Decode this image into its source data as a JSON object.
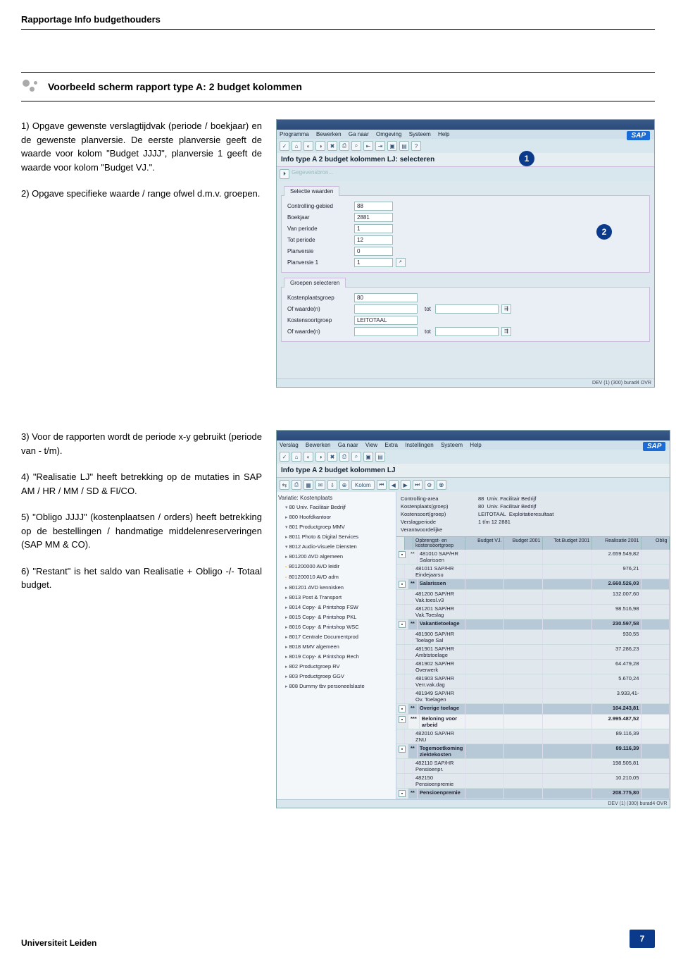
{
  "doc_header": "Rapportage Info budgethouders",
  "section_title": "Voorbeeld scherm rapport type A: 2 budget kolommen",
  "paragraphs_block1": [
    "1) Opgave gewenste verslagtijdvak (periode / boekjaar) en de gewenste planversie. De eerste planversie geeft de waarde voor kolom \"Budget JJJJ\", planversie 1 geeft de waarde voor kolom \"Budget VJ.\".",
    "2) Opgave specifieke waarde / range ofwel d.m.v. groepen."
  ],
  "paragraphs_block2": [
    "3) Voor de rapporten wordt de periode x-y gebruikt (periode van - t/m).",
    "4) \"Realisatie LJ\" heeft betrekking op de mutaties in SAP AM / HR / MM / SD & FI/CO.",
    "5) \"Obligo JJJJ\" (kostenplaatsen / orders) heeft betrekking op de bestellingen / handmatige middelenreserveringen (SAP MM & CO).",
    "6) \"Restant\" is het saldo van Realisatie + Obligo -/- Totaal budget."
  ],
  "badges": {
    "b1": "1",
    "b2": "2"
  },
  "sap1": {
    "menubar": [
      "Programma",
      "Bewerken",
      "Ga naar",
      "Omgeving",
      "Systeem",
      "Help"
    ],
    "subtitle": "Info type A 2 budget kolommen LJ: selecteren",
    "gegevensbron": "Gegevensbron...",
    "tab_sel": "Selectie waarden",
    "fields": {
      "controlling": {
        "label": "Controlling-gebied",
        "value": "88"
      },
      "boekjaar": {
        "label": "Boekjaar",
        "value": "2881"
      },
      "van_periode": {
        "label": "Van periode",
        "value": "1"
      },
      "tot_periode": {
        "label": "Tot periode",
        "value": "12"
      },
      "planversie": {
        "label": "Planversie",
        "value": "0"
      },
      "planversie1": {
        "label": "Planversie 1",
        "value": "1"
      }
    },
    "tab_grp": "Groepen selecteren",
    "group_fields": {
      "kostenplaatsgroep": {
        "label": "Kostenplaatsgroep",
        "value": "80"
      },
      "of_waarde1": {
        "label": "Of waarde(n)",
        "tot": "tot"
      },
      "kostensoortgroep": {
        "label": "Kostensoortgroep",
        "value": "LEITOTAAL"
      },
      "of_waarde2": {
        "label": "Of waarde(n)",
        "tot": "tot"
      }
    },
    "status": "DEV (1) (300)   burad4  OVR"
  },
  "sap2": {
    "menubar": [
      "Verslag",
      "Bewerken",
      "Ga naar",
      "View",
      "Extra",
      "Instellingen",
      "Systeem",
      "Help"
    ],
    "subtitle": "Info type A 2 budget kolommen LJ",
    "tree_header": "Variatie: Kostenplaats",
    "tree": [
      {
        "t": "open",
        "label": "80 Univ. Facilitair Bedrijf"
      },
      {
        "t": "fold",
        "label": "800 Hoofdkantoor"
      },
      {
        "t": "open",
        "label": "801 Productgroep MMV"
      },
      {
        "t": "fold",
        "label": "8011 Photo & Digital Services"
      },
      {
        "t": "open",
        "label": "8012 Audio-Visuele Diensten"
      },
      {
        "t": "fold",
        "label": "801200 AVD algemeen"
      },
      {
        "t": "leaf",
        "label": "801200000 AVD leidir"
      },
      {
        "t": "leaf",
        "label": "801200010 AVD adm"
      },
      {
        "t": "fold",
        "label": "801201 AVD kennisken"
      },
      {
        "t": "fold",
        "label": "8013 Post & Transport"
      },
      {
        "t": "fold",
        "label": "8014 Copy- & Printshop FSW"
      },
      {
        "t": "fold",
        "label": "8015 Copy- & Printshop PKL"
      },
      {
        "t": "fold",
        "label": "8016 Copy- & Printshop WSC"
      },
      {
        "t": "fold",
        "label": "8017 Centrale Documentprod"
      },
      {
        "t": "fold",
        "label": "8018 MMV algemeen"
      },
      {
        "t": "fold",
        "label": "8019 Copy- & Printshop Rech"
      },
      {
        "t": "fold",
        "label": "802 Productgroep RV"
      },
      {
        "t": "fold",
        "label": "803 Productgroep GGV"
      },
      {
        "t": "fold",
        "label": "808 Dummy tbv personeelslaste"
      }
    ],
    "meta": {
      "r1": {
        "l": "Controlling-area",
        "v": "88",
        "v2": "Univ. Facilitair Bedrijf"
      },
      "r2": {
        "l": "Kostenplaats(groep)",
        "v": "80",
        "v2": "Univ. Facilitair Bedrijf"
      },
      "r3": {
        "l": "Kostensoort(groep)",
        "v": "LEITOTAAL",
        "v2": "Exploitatieresultaat"
      },
      "r4": {
        "l": "Verslagperiode",
        "v": "1 t/m 12 2881"
      },
      "r5": {
        "l": "Verantwoordelijke",
        "v": ""
      }
    },
    "grid_headers": {
      "desc": "Opbrengst- en kostensoortgroep",
      "bvj": "Budget VJ.",
      "b01": "Budget 2001",
      "tot": "Tot.Budget 2001",
      "real": "Realisatie 2001",
      "ob": "Oblig"
    },
    "rows": [
      {
        "star": "**",
        "code": "481010",
        "desc": "SAP/HR Salarissen",
        "real": "2.659.549,82"
      },
      {
        "code": "481011",
        "desc": "SAP/HR Eindejaarsu",
        "real": "976,21"
      },
      {
        "sum": true,
        "star": "**",
        "desc": "Salarissen",
        "real": "2.660.526,03"
      },
      {
        "code": "481200",
        "desc": "SAP/HR Vak.toesl.v3",
        "real": "132.007,60"
      },
      {
        "code": "481201",
        "desc": "SAP/HR Vak.Toeslag",
        "real": "98.516,98"
      },
      {
        "sum": true,
        "star": "**",
        "desc": "Vakantietoelage",
        "real": "230.597,58"
      },
      {
        "code": "481900",
        "desc": "SAP/HR Toelage Sal",
        "real": "930,55"
      },
      {
        "code": "481901",
        "desc": "SAP/HR Ambtstoelage",
        "real": "37.286,23"
      },
      {
        "code": "481902",
        "desc": "SAP/HR Overwerk",
        "real": "64.479,28"
      },
      {
        "code": "481903",
        "desc": "SAP/HR Verr.vak.dag",
        "real": "5.670,24"
      },
      {
        "code": "481949",
        "desc": "SAP/HR Ov. Toelagen",
        "real": "3.933,41-"
      },
      {
        "sum": true,
        "star": "**",
        "desc": "Overige toelage",
        "real": "104.243,81"
      },
      {
        "star": "***",
        "desc": "Beloning voor arbeid",
        "real": "2.995.487,52"
      },
      {
        "code": "482010",
        "desc": "SAP/HR ZNU",
        "real": "89.116,39"
      },
      {
        "sum": true,
        "star": "**",
        "desc": "Tegemoetkoming ziektekosten",
        "real": "89.116,39"
      },
      {
        "code": "482110",
        "desc": "SAP/HR Pensioenpr.",
        "real": "198.505,81"
      },
      {
        "code": "482150",
        "desc": "Pensioenpremie",
        "real": "10.210,05"
      },
      {
        "sum": true,
        "star": "**",
        "desc": "Pensioenpremie",
        "real": "208.775,80"
      }
    ],
    "status": "DEV (1) (300)   burad4  OVR",
    "kolom_btn": "Kolom"
  },
  "footer": {
    "org": "Universiteit Leiden",
    "page": "7"
  }
}
